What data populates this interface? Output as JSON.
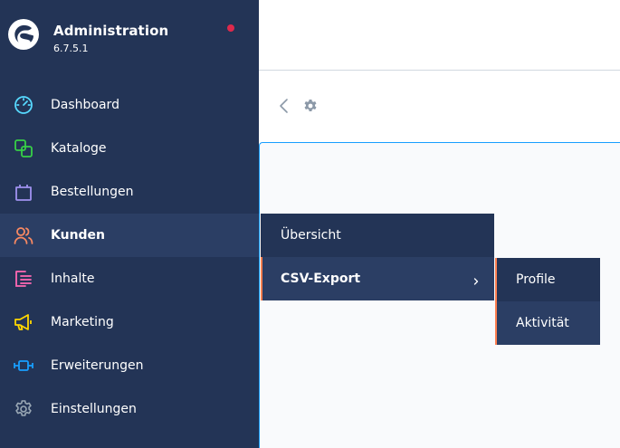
{
  "brand": {
    "title": "Administration",
    "version": "6.7.5.1",
    "status_color": "#de294c"
  },
  "sidebar": {
    "items": [
      {
        "label": "Dashboard",
        "icon": "dashboard-icon",
        "color": "#57d9ff"
      },
      {
        "label": "Kataloge",
        "icon": "catalogs-icon",
        "color": "#37d046"
      },
      {
        "label": "Bestellungen",
        "icon": "orders-icon",
        "color": "#a092f0"
      },
      {
        "label": "Kunden",
        "icon": "customers-icon",
        "color": "#f88962",
        "active": true
      },
      {
        "label": "Inhalte",
        "icon": "content-icon",
        "color": "#ff68b4"
      },
      {
        "label": "Marketing",
        "icon": "marketing-icon",
        "color": "#ffd700"
      },
      {
        "label": "Erweiterungen",
        "icon": "extensions-icon",
        "color": "#189eff"
      },
      {
        "label": "Einstellungen",
        "icon": "settings-icon",
        "color": "#9aa8b5"
      }
    ]
  },
  "toolbar": {
    "back_icon": "chevron-left-icon",
    "settings_icon": "gear-icon"
  },
  "flyout": {
    "items": [
      {
        "label": "Übersicht"
      },
      {
        "label": "CSV-Export",
        "has_children": true
      }
    ]
  },
  "subflyout": {
    "items": [
      {
        "label": "Profile"
      },
      {
        "label": "Aktivität"
      }
    ]
  },
  "colors": {
    "sidebar_bg": "#233456",
    "active_bg": "#2b3e64",
    "accent": "#ff7f50",
    "focus_border": "#189eff"
  }
}
